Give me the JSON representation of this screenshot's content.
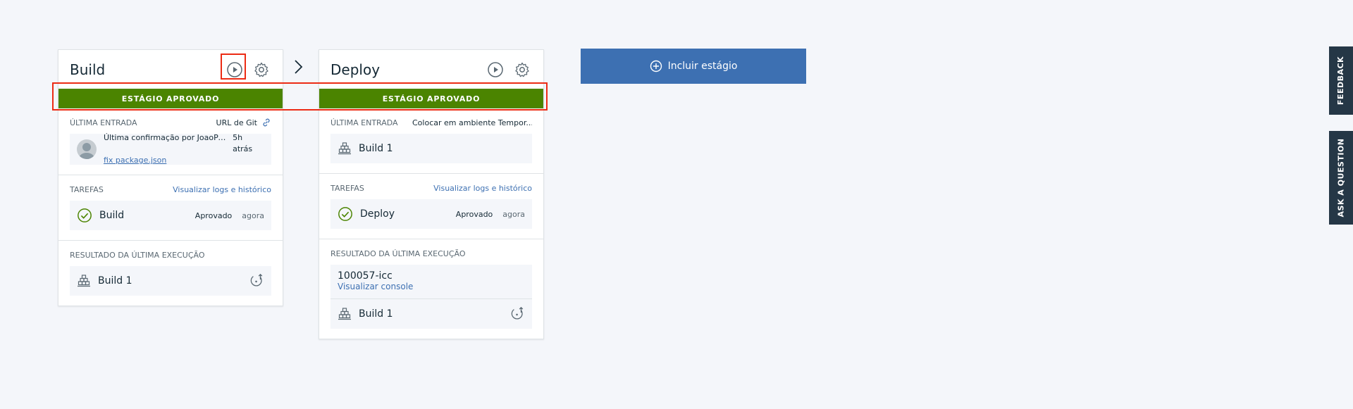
{
  "stages": [
    {
      "title": "Build",
      "status": "ESTÁGIO APROVADO",
      "last_input_label": "ÚLTIMA ENTRADA",
      "last_input_value": "URL de Git",
      "commit_message": "Última confirmação por JoaoPe...",
      "commit_time": "5h atrás",
      "commit_link": "fix package.json",
      "tasks_label": "TAREFAS",
      "tasks_link": "Visualizar logs e histórico",
      "task_name": "Build",
      "task_status": "Aprovado",
      "task_time": "agora",
      "result_label": "RESULTADO DA ÚLTIMA EXECUÇÃO",
      "artifact": "Build 1"
    },
    {
      "title": "Deploy",
      "status": "ESTÁGIO APROVADO",
      "last_input_label": "ÚLTIMA ENTRADA",
      "last_input_value": "Colocar em ambiente Tempor...",
      "input_artifact": "Build 1",
      "tasks_label": "TAREFAS",
      "tasks_link": "Visualizar logs e histórico",
      "task_name": "Deploy",
      "task_status": "Aprovado",
      "task_time": "agora",
      "result_label": "RESULTADO DA ÚLTIMA EXECUÇÃO",
      "exec_id": "100057-icc",
      "exec_console": "Visualizar console",
      "artifact": "Build 1"
    }
  ],
  "add_stage_label": "Incluir estágio",
  "side_tabs": {
    "feedback": "FEEDBACK",
    "question": "ASK A QUESTION"
  },
  "colors": {
    "approved": "#4b8400",
    "accent": "#3d70b2",
    "highlight": "#ec2b14",
    "side_tab": "#253746"
  }
}
